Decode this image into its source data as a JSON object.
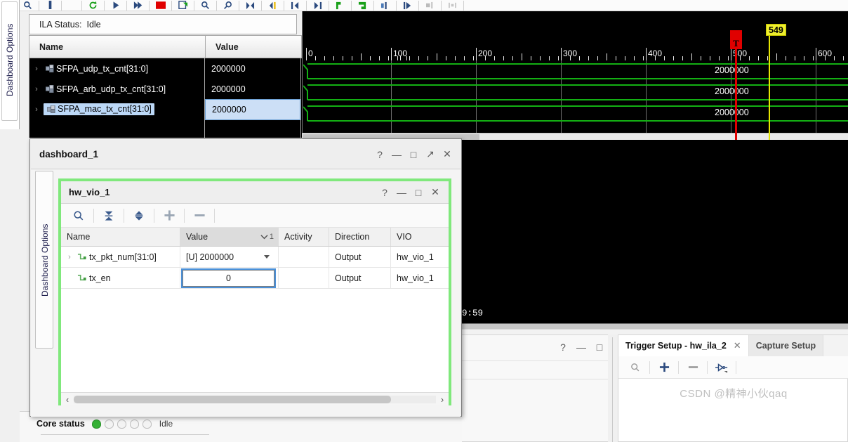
{
  "app": {
    "left_vertical_tab": "Dashboard Options",
    "inner_vertical_tab": "Dashboard Options"
  },
  "toolbar": {
    "icons": [
      "search-icon",
      "measure-icon",
      "refresh-icon",
      "run-icon",
      "run-all-icon",
      "stop-icon",
      "export-icon",
      "zoom-in-icon",
      "zoom-out-icon",
      "zoom-fit-icon",
      "goto-start-icon",
      "prev-transition-icon",
      "next-transition-icon",
      "add-marker-icon",
      "remove-marker-icon",
      "prev-marker-icon",
      "next-marker-icon",
      "disabled-a-icon",
      "disabled-b-icon"
    ]
  },
  "ila": {
    "status_label": "ILA Status:",
    "status_value": "Idle",
    "columns": [
      "Name",
      "Value"
    ],
    "signals": [
      {
        "name": "SFPA_udp_tx_cnt[31:0]",
        "value": "2000000",
        "selected": false,
        "expand": "›"
      },
      {
        "name": "SFPA_arb_udp_tx_cnt[31:0]",
        "value": "2000000",
        "selected": false,
        "expand": "›"
      },
      {
        "name": "SFPA_mac_tx_cnt[31:0]",
        "value": "2000000",
        "selected": true,
        "expand": "›"
      }
    ]
  },
  "waveform": {
    "ruler_labels": [
      "0",
      "100",
      "200",
      "300",
      "400",
      "500",
      "600"
    ],
    "trigger_marker": {
      "label": "T",
      "color": "#e00000"
    },
    "cursor_marker": {
      "label": "549",
      "color": "#efef2e"
    },
    "wave_value_label": "2000000",
    "signal_color": "#13b013",
    "rows": [
      "2000000",
      "2000000",
      "2000000"
    ]
  },
  "black_panel": {
    "timestamp": "9:59"
  },
  "dashboard": {
    "title": "dashboard_1",
    "window_buttons": [
      "?",
      "—",
      "□",
      "↗",
      "✕"
    ]
  },
  "vio": {
    "title": "hw_vio_1",
    "window_buttons": [
      "?",
      "—",
      "□",
      "✕"
    ],
    "toolbar_icons": [
      "search-icon",
      "collapse-all-icon",
      "expand-all-icon",
      "add-probes-icon",
      "remove-probes-icon"
    ],
    "columns": [
      "Name",
      "Value",
      "Activity",
      "Direction",
      "VIO"
    ],
    "sort_indicator": "1",
    "rows": [
      {
        "expand": "›",
        "name": "tx_pkt_num[31:0]",
        "value": "[U] 2000000",
        "value_kind": "combo",
        "activity": "",
        "direction": "Output",
        "vio": "hw_vio_1"
      },
      {
        "expand": "",
        "name": "tx_en",
        "value": "0",
        "value_kind": "edit",
        "activity": "",
        "direction": "Output",
        "vio": "hw_vio_1"
      }
    ]
  },
  "core_status": {
    "label": "Core status",
    "state": "Idle",
    "leds": [
      true,
      false,
      false,
      false,
      false
    ],
    "on_color": "#35b135"
  },
  "trigger_setup": {
    "tabs": [
      {
        "label": "Trigger Setup - hw_ila_2",
        "active": true,
        "closable": true,
        "close": "✕"
      },
      {
        "label": "Capture Setup",
        "active": false,
        "closable": false,
        "close": ""
      }
    ],
    "toolbar_icons": [
      "search-icon",
      "add-probe-icon",
      "remove-probe-icon",
      "trigger-logic-icon"
    ]
  },
  "mid_panel": {
    "window_buttons": [
      "?",
      "—",
      "□"
    ]
  },
  "watermark": {
    "text": "CSDN @精神小伙qaq"
  }
}
